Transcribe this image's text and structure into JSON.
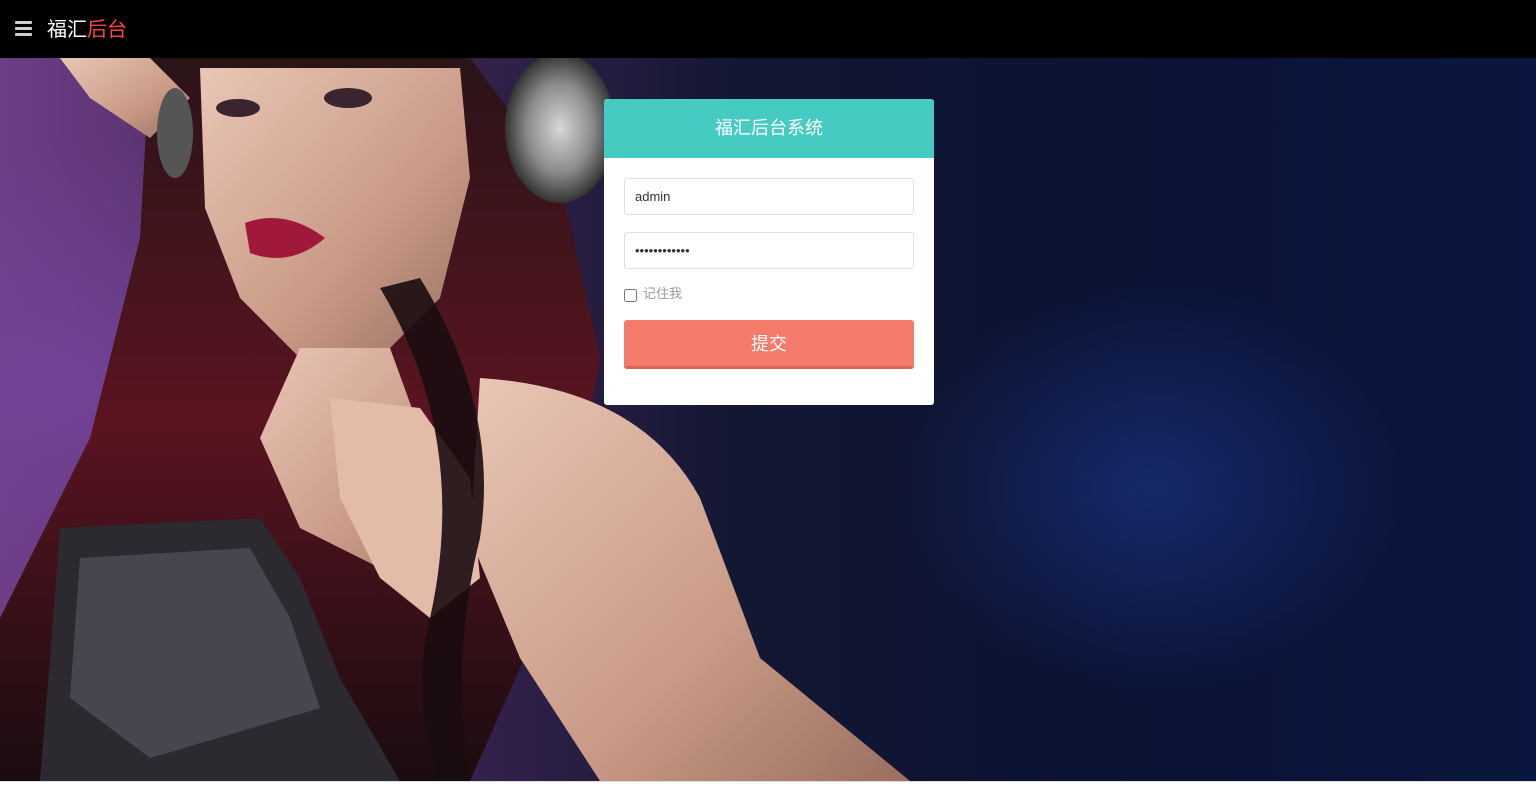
{
  "header": {
    "brand_part1": "福汇",
    "brand_part2": "后台",
    "menu_icon": "hamburger-menu-icon"
  },
  "login": {
    "title": "福汇后台系统",
    "username_value": "admin",
    "password_value": "************",
    "remember_label": "记住我",
    "remember_checked": false,
    "submit_label": "提交"
  },
  "colors": {
    "topbar": "#000000",
    "brand_accent": "#ff4444",
    "login_header": "#45cbc1",
    "submit_button": "#f47a6c"
  },
  "background": {
    "image": "woman-with-headphones-photo"
  }
}
